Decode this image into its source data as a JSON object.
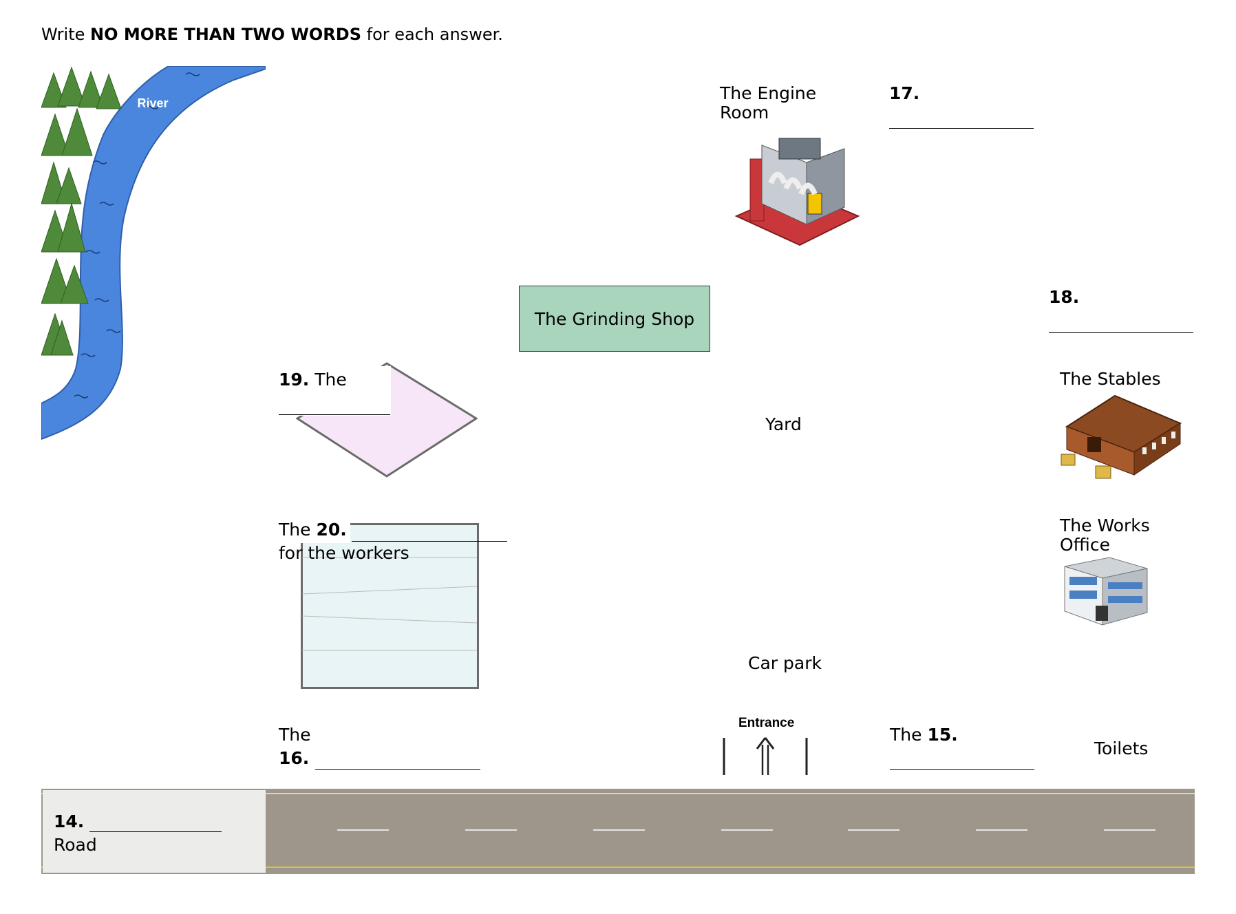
{
  "instruction": {
    "prefix": "Write ",
    "emphasis": "NO MORE THAN TWO WORDS",
    "suffix": " for each answer."
  },
  "river": {
    "label": "River",
    "color": "#4a86de"
  },
  "buildings": {
    "engine_room": {
      "line1": "The Engine",
      "line2": "Room",
      "icon": "factory-icon"
    },
    "grinding_shop": {
      "label": "The Grinding Shop",
      "color": "#a8d5bc"
    },
    "stables": {
      "label": "The Stables",
      "icon": "barn-icon"
    },
    "works_office": {
      "line1": "The Works",
      "line2": "Office",
      "icon": "office-building-icon"
    },
    "yard": {
      "label": "Yard"
    },
    "car_park": {
      "label": "Car park"
    },
    "toilets": {
      "label": "Toilets"
    },
    "entrance": {
      "label": "Entrance",
      "icon": "arrow-up-icon"
    }
  },
  "questions": {
    "q14": {
      "num": "14.",
      "after": "Road"
    },
    "q15": {
      "before": "The ",
      "num": "15."
    },
    "q16": {
      "before": "The",
      "num": "16."
    },
    "q17": {
      "num": "17."
    },
    "q18": {
      "num": "18."
    },
    "q19": {
      "num": "19.",
      "after": " The"
    },
    "q20": {
      "before": "The ",
      "num": "20.",
      "after": "for the workers"
    }
  },
  "colors": {
    "diamond_fill": "#f7e6f7",
    "pool_fill": "#e8f4f6",
    "road": "#9e968a",
    "road_label_bg": "#ececea"
  }
}
